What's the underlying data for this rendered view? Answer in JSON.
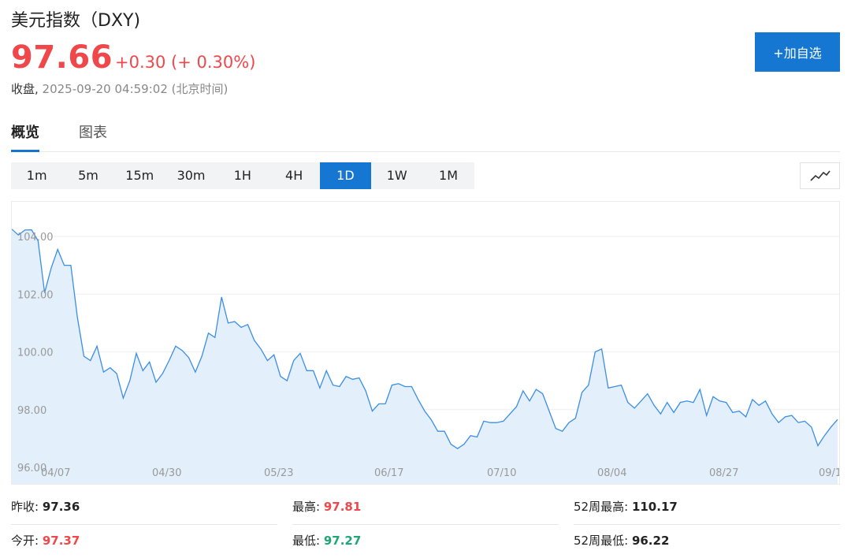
{
  "header": {
    "title": "美元指数（DXY)",
    "price": "97.66",
    "change": "+0.30 (+ 0.30%)",
    "close_label": "收盘,",
    "close_time": " 2025-09-20 04:59:02 (北京时间)",
    "add_button": "+加自选"
  },
  "tabs": [
    {
      "label": "概览",
      "active": true
    },
    {
      "label": "图表",
      "active": false
    }
  ],
  "periods": [
    {
      "label": "1m",
      "active": false
    },
    {
      "label": "5m",
      "active": false
    },
    {
      "label": "15m",
      "active": false
    },
    {
      "label": "30m",
      "active": false
    },
    {
      "label": "1H",
      "active": false
    },
    {
      "label": "4H",
      "active": false
    },
    {
      "label": "1D",
      "active": true
    },
    {
      "label": "1W",
      "active": false
    },
    {
      "label": "1M",
      "active": false
    }
  ],
  "chart_toggle_icon": "line-chart-icon",
  "colors": {
    "up": "#f0474b",
    "down": "#1ea776",
    "accent": "#1677d2",
    "line": "#3a8ee6",
    "area": "#e3effb"
  },
  "chart_data": {
    "type": "area",
    "yticks": [
      "104.00",
      "102.00",
      "100.00",
      "98.00",
      "96.00"
    ],
    "ylim": [
      96.0,
      104.25
    ],
    "xticks": [
      "04/07",
      "04/30",
      "05/23",
      "06/17",
      "07/10",
      "08/04",
      "08/27",
      "09/1"
    ],
    "grid": true,
    "values": [
      104.25,
      104.05,
      104.22,
      104.23,
      103.85,
      102.05,
      102.9,
      103.55,
      103.0,
      103.0,
      101.2,
      99.85,
      99.7,
      100.2,
      99.3,
      99.45,
      99.25,
      98.4,
      99.0,
      99.95,
      99.35,
      99.65,
      98.95,
      99.25,
      99.7,
      100.2,
      100.05,
      99.8,
      99.3,
      99.85,
      100.65,
      100.5,
      101.9,
      101.0,
      101.05,
      100.85,
      100.95,
      100.4,
      100.1,
      99.7,
      99.9,
      99.15,
      99.0,
      99.7,
      99.95,
      99.35,
      99.35,
      98.75,
      99.35,
      98.85,
      98.8,
      99.15,
      99.05,
      99.1,
      98.65,
      97.95,
      98.2,
      98.2,
      98.85,
      98.9,
      98.8,
      98.8,
      98.35,
      97.95,
      97.65,
      97.25,
      97.25,
      96.8,
      96.65,
      96.8,
      97.1,
      97.05,
      97.6,
      97.55,
      97.55,
      97.6,
      97.85,
      98.1,
      98.65,
      98.3,
      98.7,
      98.55,
      97.95,
      97.35,
      97.25,
      97.55,
      97.7,
      98.6,
      98.85,
      100.0,
      100.1,
      98.75,
      98.8,
      98.85,
      98.25,
      98.05,
      98.3,
      98.55,
      98.15,
      97.85,
      98.25,
      97.9,
      98.25,
      98.3,
      98.25,
      98.7,
      97.8,
      98.45,
      98.3,
      98.25,
      97.9,
      97.95,
      97.75,
      98.35,
      98.15,
      98.3,
      97.85,
      97.55,
      97.75,
      97.8,
      97.55,
      97.6,
      97.4,
      96.75,
      97.1,
      97.4,
      97.66
    ]
  },
  "stats": [
    {
      "label": "昨收:",
      "value": "97.36",
      "color": "dark"
    },
    {
      "label": "最高:",
      "value": "97.81",
      "color": "red"
    },
    {
      "label": "52周最高:",
      "value": "110.17",
      "color": "dark"
    },
    {
      "label": "今开:",
      "value": "97.37",
      "color": "red"
    },
    {
      "label": "最低:",
      "value": "97.27",
      "color": "green"
    },
    {
      "label": "52周最低:",
      "value": "96.22",
      "color": "dark"
    }
  ]
}
